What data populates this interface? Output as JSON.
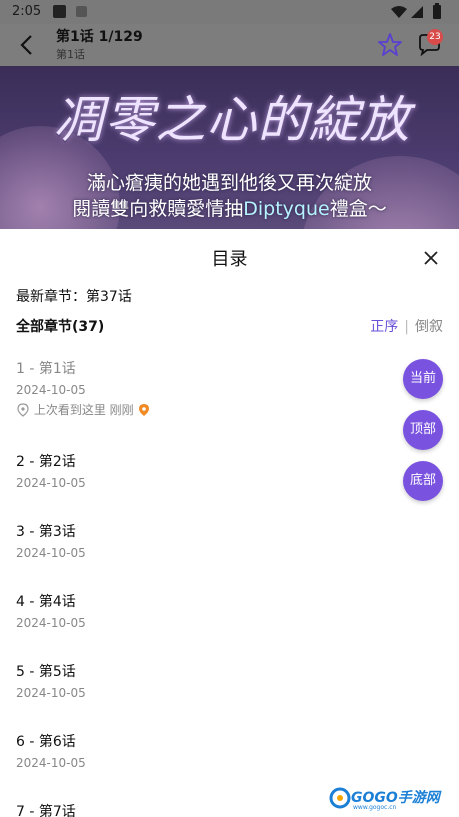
{
  "status_bar": {
    "time": "2:05",
    "icons": [
      "app-notification-icon",
      "app-notification-icon",
      "wifi-icon",
      "signal-icon",
      "battery-icon"
    ]
  },
  "app_bar": {
    "title": "第1话  1/129",
    "subtitle": "第1话",
    "comment_badge": "23",
    "icons": [
      "back-arrow-icon",
      "star-icon",
      "comment-icon"
    ]
  },
  "banner": {
    "headline": "凋零之心的綻放",
    "line1": "滿心瘡痍的她遇到他後又再次綻放",
    "line2_prefix": "閱讀雙向救贖愛情抽",
    "line2_highlight": "Diptyque",
    "line2_suffix": "禮盒～"
  },
  "catalog": {
    "title": "目录",
    "latest": "最新章节：第37话",
    "all_chapters": "全部章节(37)",
    "sort_asc": "正序",
    "sort_sep": "|",
    "sort_desc": "倒叙",
    "accent_color": "#6a4fd8",
    "chapters": [
      {
        "name": "1 - 第1话",
        "date": "2024-10-05",
        "last_read_text": "上次看到这里  刚刚",
        "read": true
      },
      {
        "name": "2 - 第2话",
        "date": "2024-10-05"
      },
      {
        "name": "3 - 第3话",
        "date": "2024-10-05"
      },
      {
        "name": "4 - 第4话",
        "date": "2024-10-05"
      },
      {
        "name": "5 - 第5话",
        "date": "2024-10-05"
      },
      {
        "name": "6 - 第6话",
        "date": "2024-10-05"
      },
      {
        "name": "7 - 第7话",
        "date": ""
      }
    ]
  },
  "fabs": {
    "current": "当前",
    "top": "顶部",
    "bottom": "底部",
    "color": "#7a52e0"
  },
  "watermark": {
    "main": "GOGO手游网",
    "sub": "www.gogoc.cn"
  }
}
